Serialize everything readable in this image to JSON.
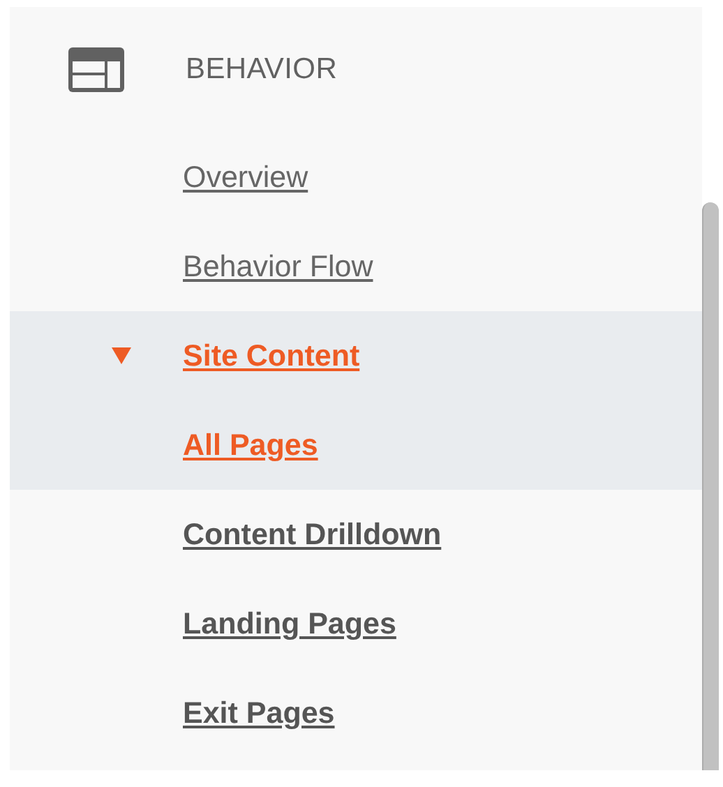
{
  "section": {
    "title": "BEHAVIOR"
  },
  "items": [
    {
      "kind": "link",
      "label": "Overview",
      "selected": false
    },
    {
      "kind": "link",
      "label": "Behavior Flow",
      "selected": false
    },
    {
      "kind": "group",
      "label": "Site Content",
      "expanded": true,
      "children": [
        {
          "label": "All Pages",
          "selected": true
        },
        {
          "label": "Content Drilldown",
          "selected": false
        },
        {
          "label": "Landing Pages",
          "selected": false
        },
        {
          "label": "Exit Pages",
          "selected": false
        }
      ]
    }
  ]
}
